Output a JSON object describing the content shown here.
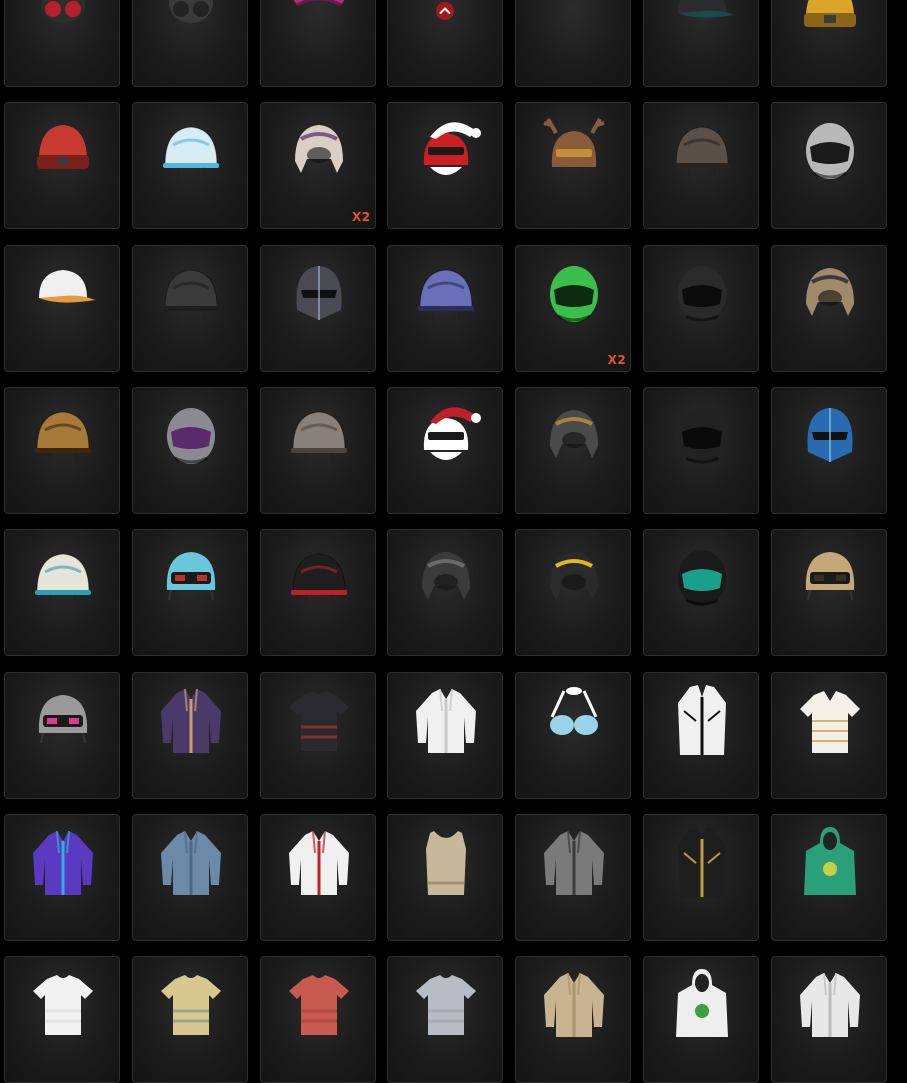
{
  "inventory": {
    "scroll_up_icon": "chevron-up-icon",
    "items": [
      {
        "name": "gas-mask",
        "kind": "mask",
        "c1": "#2d2d2d",
        "c2": "#b5202a",
        "badge": ""
      },
      {
        "name": "bandana-mask",
        "kind": "mask",
        "c1": "#3a3a3a",
        "c2": "#232323",
        "badge": ""
      },
      {
        "name": "pink-visor",
        "kind": "visor",
        "c1": "#b0306f",
        "c2": "#6a1a44",
        "badge": ""
      },
      {
        "name": "heart-glasses",
        "kind": "glasses",
        "c1": "#c8202c",
        "c2": "#5e1015",
        "badge": ""
      },
      {
        "name": "aviator-glasses",
        "kind": "glasses",
        "c1": "#a88740",
        "c2": "#3a3020",
        "badge": ""
      },
      {
        "name": "black-cap",
        "kind": "cap",
        "c1": "#2b2b2b",
        "c2": "#1a4a4a",
        "badge": ""
      },
      {
        "name": "yellow-beanie",
        "kind": "beanie",
        "c1": "#d9a52a",
        "c2": "#8a6616",
        "badge": ""
      },
      {
        "name": "red-beanie",
        "kind": "beanie",
        "c1": "#c63a30",
        "c2": "#7a1f19",
        "badge": ""
      },
      {
        "name": "ice-helmet",
        "kind": "helmet",
        "c1": "#d8ecf4",
        "c2": "#4fb6df",
        "badge": ""
      },
      {
        "name": "retro-open-face-helmet",
        "kind": "openface",
        "c1": "#d9cfc4",
        "c2": "#7a5a86",
        "badge": "X2"
      },
      {
        "name": "santa-helmet",
        "kind": "santa",
        "c1": "#cc1f24",
        "c2": "#ffffff",
        "badge": ""
      },
      {
        "name": "reindeer-helmet",
        "kind": "reindeer",
        "c1": "#8a5a3a",
        "c2": "#c2913a",
        "badge": ""
      },
      {
        "name": "plaid-helmet",
        "kind": "helmet",
        "c1": "#5a5048",
        "c2": "#2a2420",
        "badge": ""
      },
      {
        "name": "silver-moto-helmet",
        "kind": "moto",
        "c1": "#b8b8b8",
        "c2": "#1a1a1a",
        "badge": ""
      },
      {
        "name": "baseball-cap",
        "kind": "cap",
        "c1": "#f0f0f0",
        "c2": "#e89a40",
        "badge": ""
      },
      {
        "name": "black-military-helmet",
        "kind": "helmet",
        "c1": "#3a3a3a",
        "c2": "#1e1e1e",
        "badge": ""
      },
      {
        "name": "carbon-knight-helmet",
        "kind": "knight",
        "c1": "#4a4a52",
        "c2": "#9aa6c0",
        "badge": ""
      },
      {
        "name": "hex-helmet",
        "kind": "helmet",
        "c1": "#6a70b8",
        "c2": "#2a2e5a",
        "badge": ""
      },
      {
        "name": "green-moto-helmet",
        "kind": "moto",
        "c1": "#3cbf4a",
        "c2": "#0e2a12",
        "badge": "X2"
      },
      {
        "name": "black-moto-helmet",
        "kind": "moto",
        "c1": "#2a2a2a",
        "c2": "#0c0c0c",
        "badge": ""
      },
      {
        "name": "aviator-goggles-helmet",
        "kind": "openface",
        "c1": "#a08a6a",
        "c2": "#3a3a40",
        "badge": ""
      },
      {
        "name": "leopard-helmet",
        "kind": "helmet",
        "c1": "#a87a3a",
        "c2": "#3a2510",
        "badge": ""
      },
      {
        "name": "purple-visor-moto",
        "kind": "moto",
        "c1": "#8a8a90",
        "c2": "#5a2a6a",
        "badge": ""
      },
      {
        "name": "camo-helmet",
        "kind": "helmet",
        "c1": "#8a807a",
        "c2": "#4a4440",
        "badge": ""
      },
      {
        "name": "jester-helmet",
        "kind": "santa",
        "c1": "#ffffff",
        "c2": "#c0202a",
        "badge": ""
      },
      {
        "name": "bronze-open-helmet",
        "kind": "openface",
        "c1": "#4a4a4a",
        "c2": "#a8843a",
        "badge": ""
      },
      {
        "name": "matte-black-moto",
        "kind": "moto",
        "c1": "#222222",
        "c2": "#0a0a0a",
        "badge": ""
      },
      {
        "name": "blue-samurai-helmet",
        "kind": "knight",
        "c1": "#2a6ab0",
        "c2": "#7ac0e0",
        "badge": ""
      },
      {
        "name": "white-greek-helmet",
        "kind": "helmet",
        "c1": "#e8e4dc",
        "c2": "#2aa0b0",
        "badge": ""
      },
      {
        "name": "cyan-level3-helmet",
        "kind": "level3",
        "c1": "#6ac6dc",
        "c2": "#c0302a",
        "badge": ""
      },
      {
        "name": "rock-helmet",
        "kind": "helmet",
        "c1": "#1e1e1e",
        "c2": "#c0202a",
        "badge": ""
      },
      {
        "name": "pilot-helmet",
        "kind": "openface",
        "c1": "#3a3a3a",
        "c2": "#6a6a6a",
        "badge": ""
      },
      {
        "name": "yellow-flame-helmet",
        "kind": "openface",
        "c1": "#2a2a2a",
        "c2": "#e0b820",
        "badge": ""
      },
      {
        "name": "teal-moto-helmet",
        "kind": "moto",
        "c1": "#1a1a1a",
        "c2": "#1aa08a",
        "badge": ""
      },
      {
        "name": "tan-level3-helmet",
        "kind": "level3",
        "c1": "#c4a878",
        "c2": "#3a3020",
        "badge": ""
      },
      {
        "name": "bear-level3-helmet",
        "kind": "level3",
        "c1": "#9a9a9a",
        "c2": "#e03a8a",
        "badge": ""
      },
      {
        "name": "purple-bomber-jacket",
        "kind": "jacket",
        "c1": "#4a3a6a",
        "c2": "#c8a070",
        "badge": ""
      },
      {
        "name": "crop-top",
        "kind": "tshirt",
        "c1": "#2a2a2e",
        "c2": "#c0303a",
        "badge": ""
      },
      {
        "name": "white-jacket",
        "kind": "jacket",
        "c1": "#f0f0f0",
        "c2": "#c8c8c8",
        "badge": ""
      },
      {
        "name": "blue-bikini-top",
        "kind": "bikini",
        "c1": "#9ad4ea",
        "c2": "#ffffff",
        "badge": ""
      },
      {
        "name": "zebra-coat",
        "kind": "coat",
        "c1": "#f0f0f0",
        "c2": "#111111",
        "badge": ""
      },
      {
        "name": "striped-polo",
        "kind": "polo",
        "c1": "#f2f0e8",
        "c2": "#d8b070",
        "badge": ""
      },
      {
        "name": "holo-jacket",
        "kind": "jacket",
        "c1": "#5a3ac0",
        "c2": "#30b0e0",
        "badge": ""
      },
      {
        "name": "denim-shirt",
        "kind": "jacket",
        "c1": "#6a8aa8",
        "c2": "#4a6a88",
        "badge": ""
      },
      {
        "name": "racing-jacket",
        "kind": "jacket",
        "c1": "#f0f0f0",
        "c2": "#c0202a",
        "badge": ""
      },
      {
        "name": "tank-top",
        "kind": "tank",
        "c1": "#c8b89a",
        "c2": "#a0906e",
        "badge": ""
      },
      {
        "name": "gray-leather-jacket",
        "kind": "jacket",
        "c1": "#7a7a7a",
        "c2": "#3a3a3a",
        "badge": ""
      },
      {
        "name": "black-gold-coat",
        "kind": "coat",
        "c1": "#1e1e1e",
        "c2": "#c09a40",
        "badge": ""
      },
      {
        "name": "frog-raincoat",
        "kind": "hoodie",
        "c1": "#2aa07a",
        "c2": "#c8d040",
        "badge": ""
      },
      {
        "name": "white-tshirt",
        "kind": "tshirt",
        "c1": "#f2f2f2",
        "c2": "#d8d8d8",
        "badge": ""
      },
      {
        "name": "striped-tshirt",
        "kind": "tshirt",
        "c1": "#d8c890",
        "c2": "#6a9a8a",
        "badge": ""
      },
      {
        "name": "red-tshirt",
        "kind": "tshirt",
        "c1": "#c85a50",
        "c2": "#a04038",
        "badge": ""
      },
      {
        "name": "gray-tshirt",
        "kind": "tshirt",
        "c1": "#b8bcc4",
        "c2": "#9aa0a8",
        "badge": ""
      },
      {
        "name": "tan-sweater",
        "kind": "jacket",
        "c1": "#c8b490",
        "c2": "#a8946e",
        "badge": ""
      },
      {
        "name": "white-hoodie",
        "kind": "hoodie",
        "c1": "#eeeeee",
        "c2": "#3aa040",
        "badge": ""
      },
      {
        "name": "white-blazer",
        "kind": "jacket",
        "c1": "#e8e8e8",
        "c2": "#bcbcbc",
        "badge": ""
      }
    ]
  }
}
